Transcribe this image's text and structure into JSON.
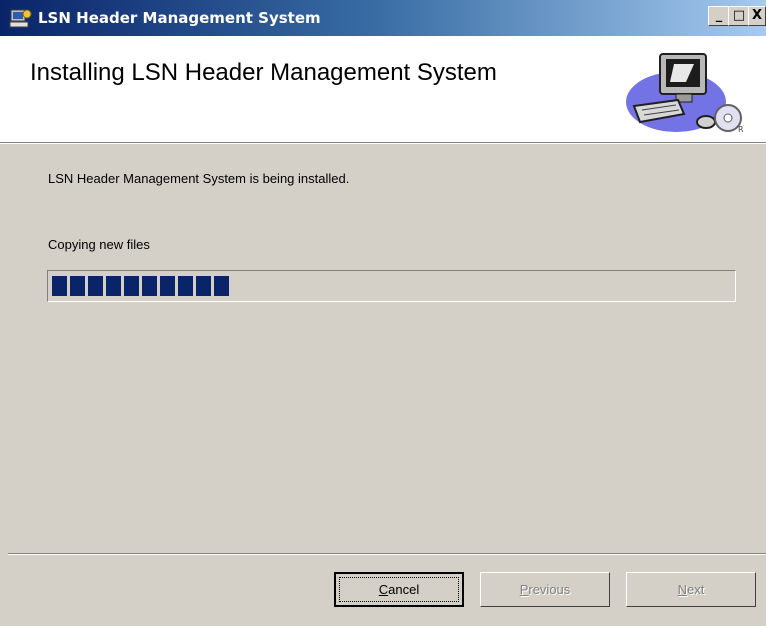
{
  "window": {
    "title": "LSN Header Management System",
    "controls": {
      "minimize": "_",
      "maximize": "□",
      "close": "X"
    }
  },
  "header": {
    "title": "Installing LSN Header Management System",
    "graphic": "computer-setup-icon"
  },
  "body": {
    "status_text": "LSN Header Management System is being installed.",
    "action_text": "Copying new files",
    "progress_blocks": 10
  },
  "buttons": {
    "cancel": {
      "label": "Cancel",
      "accel": "C",
      "state": "default"
    },
    "previous": {
      "label": "Previous",
      "accel": "P",
      "state": "disabled"
    },
    "next": {
      "label": "Next",
      "accel": "N",
      "state": "disabled"
    }
  },
  "colors": {
    "titlebar_start": "#0a246a",
    "titlebar_end": "#a6caf0",
    "face": "#d4d0c8",
    "progress_block": "#0a246a"
  }
}
